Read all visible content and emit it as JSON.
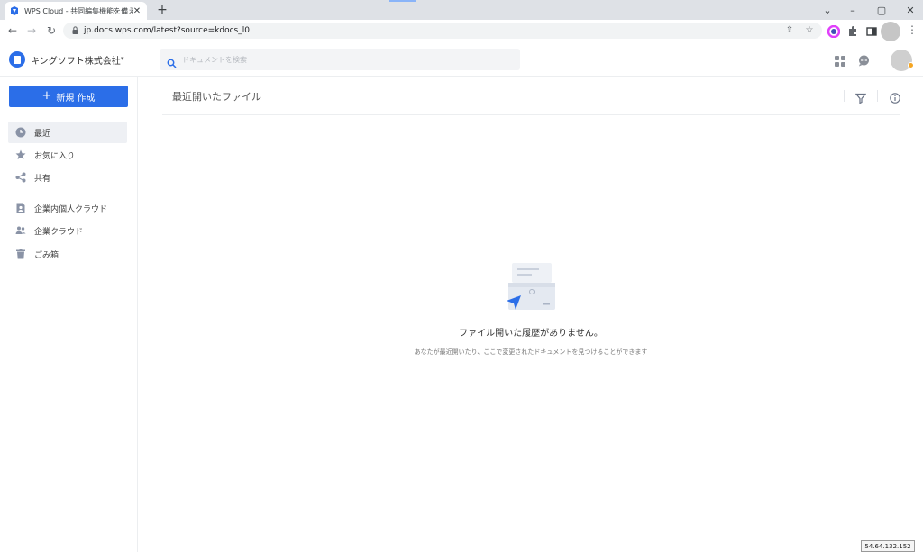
{
  "browser": {
    "tab_title": "WPS Cloud - 共同編集機能を備え",
    "tab_close": "✕",
    "new_tab": "+",
    "url": "jp.docs.wps.com/latest?source=kdocs_l0",
    "window_controls": [
      "⌄",
      "–",
      "▢",
      "✕"
    ]
  },
  "header": {
    "company_name": "キングソフト株式会社",
    "company_caret": "▾",
    "search_placeholder": "ドキュメントを検索"
  },
  "sidebar": {
    "new_button": "新規 作成",
    "items": [
      {
        "label": "最近",
        "icon": "clock-icon",
        "active": true
      },
      {
        "label": "お気に入り",
        "icon": "star-icon",
        "active": false
      },
      {
        "label": "共有",
        "icon": "share-icon",
        "active": false
      },
      {
        "label": "企業内個人クラウド",
        "icon": "personal-doc-icon",
        "active": false
      },
      {
        "label": "企業クラウド",
        "icon": "team-icon",
        "active": false
      },
      {
        "label": "ごみ箱",
        "icon": "trash-icon",
        "active": false
      }
    ]
  },
  "main": {
    "title": "最近開いたファイル",
    "empty_title": "ファイル開いた履歴がありません。",
    "empty_subtitle": "あなたが最近開いたり、ここで変更されたドキュメントを見つけることができます"
  },
  "overlay": {
    "ip_address": "54.64.132.152"
  },
  "colors": {
    "accent": "#2b6ee8",
    "active_bg": "#eef0f4",
    "tabstrip": "#dee1e6"
  }
}
